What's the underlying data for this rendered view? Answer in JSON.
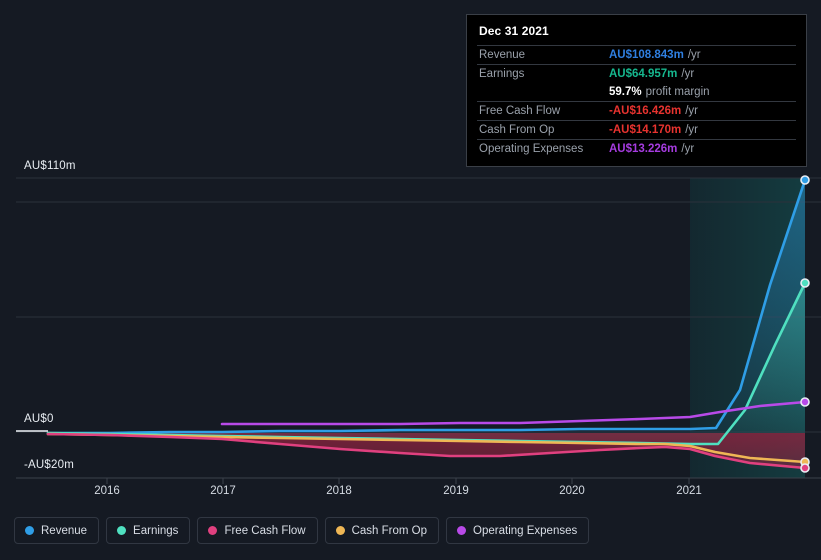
{
  "chart_data": {
    "type": "line",
    "title": "",
    "xlabel": "",
    "ylabel": "",
    "currency": "AU$",
    "units": "m",
    "x": [
      2015.4,
      2016,
      2017,
      2018,
      2019,
      2020,
      2021,
      2021.9
    ],
    "tick_labels": [
      "2016",
      "2017",
      "2018",
      "2019",
      "2020",
      "2021"
    ],
    "y_axis_labels": [
      "AU$110m",
      "AU$0",
      "-AU$20m"
    ],
    "ylim": [
      -24,
      118
    ],
    "grid": true,
    "legend_position": "bottom-left",
    "forecast_start_year": 2021,
    "series": [
      {
        "name": "Revenue",
        "color": "#2f9ee6",
        "values": [
          0.3,
          0.5,
          0.8,
          1.0,
          1.2,
          1.4,
          1.6,
          108.843
        ],
        "end_value": 108.843
      },
      {
        "name": "Earnings",
        "color": "#4fe0c0",
        "values": [
          0.1,
          -0.4,
          -1.0,
          -1.4,
          -1.8,
          -2.6,
          -3.2,
          64.957
        ],
        "end_value": 64.957
      },
      {
        "name": "Free Cash Flow",
        "color": "#e0407f",
        "values": [
          -0.2,
          -1.3,
          -4.2,
          -7.2,
          -6.0,
          -5.4,
          -9.0,
          -16.426
        ],
        "end_value": -16.426
      },
      {
        "name": "Cash From Op",
        "color": "#efb košice"
      },
      {
        "name": "Operating Expenses",
        "color": "#b84ae8",
        "values": [
          null,
          null,
          1.8,
          1.9,
          2.0,
          2.6,
          4.0,
          13.226
        ],
        "end_value": 13.226
      }
    ]
  },
  "tooltip": {
    "title": "Dec 31 2021",
    "rows": [
      {
        "key": "Revenue",
        "value": "AU$108.843m",
        "unit": "/yr",
        "color": "#2f7fe0",
        "rule": true
      },
      {
        "key": "Earnings",
        "value": "AU$64.957m",
        "unit": "/yr",
        "color": "#16b88f",
        "rule": true
      },
      {
        "key": "",
        "value": "59.7%",
        "unit": "profit margin",
        "color": "#ffffff",
        "rule": false
      },
      {
        "key": "Free Cash Flow",
        "value": "-AU$16.426m",
        "unit": "/yr",
        "color": "#e8332f",
        "rule": true
      },
      {
        "key": "Cash From Op",
        "value": "-AU$14.170m",
        "unit": "/yr",
        "color": "#e8332f",
        "rule": true
      },
      {
        "key": "Operating Expenses",
        "value": "AU$13.226m",
        "unit": "/yr",
        "color": "#a63ce0",
        "rule": true
      }
    ]
  },
  "y_axis": {
    "top": "AU$110m",
    "zero": "AU$0",
    "bottom": "-AU$20m"
  },
  "x_axis": {
    "ticks": [
      "2016",
      "2017",
      "2018",
      "2019",
      "2020",
      "2021"
    ]
  },
  "legend": {
    "items": [
      {
        "label": "Revenue",
        "color": "#2f9ee6"
      },
      {
        "label": "Earnings",
        "color": "#4fe0c0"
      },
      {
        "label": "Free Cash Flow",
        "color": "#e0407f"
      },
      {
        "label": "Cash From Op",
        "color": "#efb755"
      },
      {
        "label": "Operating Expenses",
        "color": "#b84ae8"
      }
    ]
  },
  "colors": {
    "background": "#151a23",
    "revenue": "#2f9ee6",
    "earnings": "#4fe0c0",
    "free_cash_flow": "#e0407f",
    "cash_from_op": "#efb755",
    "operating_expenses": "#b84ae8",
    "grid": "#2b313b",
    "forecast_band": "#0f2b30"
  }
}
